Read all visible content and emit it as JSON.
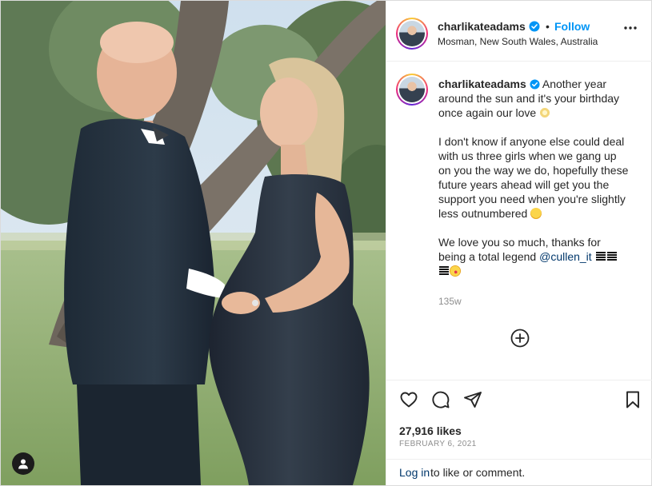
{
  "post": {
    "username": "charlikateadams",
    "follow_label": "Follow",
    "separator": "•",
    "location": "Mosman, New South Wales, Australia"
  },
  "caption": {
    "username": "charlikateadams",
    "line1": "Another year around the sun and it's your birthday once again our love",
    "line2": "I don't know if anyone else could deal with us three girls when we gang up on you the way we do, hopefully these future years ahead will get you the support you need when you're slightly less outnumbered",
    "line3_start": "We love you so much, thanks for being a total legend",
    "mention": "@cullen_it",
    "time_ago": "135w"
  },
  "stats": {
    "likes": "27,916 likes",
    "date": "FEBRUARY 6, 2021"
  },
  "comment_bar": {
    "login_label": "Log in",
    "rest": "to like or comment."
  },
  "icons": {
    "verified": "verified-badge-icon",
    "more": "more-options-icon",
    "like": "heart-icon",
    "comment": "comment-icon",
    "share": "paper-plane-icon",
    "save": "bookmark-icon",
    "load_more": "plus-circle-icon",
    "tags": "user-tag-icon"
  },
  "colors": {
    "accent": "#0095f6",
    "mention": "#00376b",
    "text": "#262626",
    "muted": "#8e8e8e",
    "border": "#efefef"
  }
}
